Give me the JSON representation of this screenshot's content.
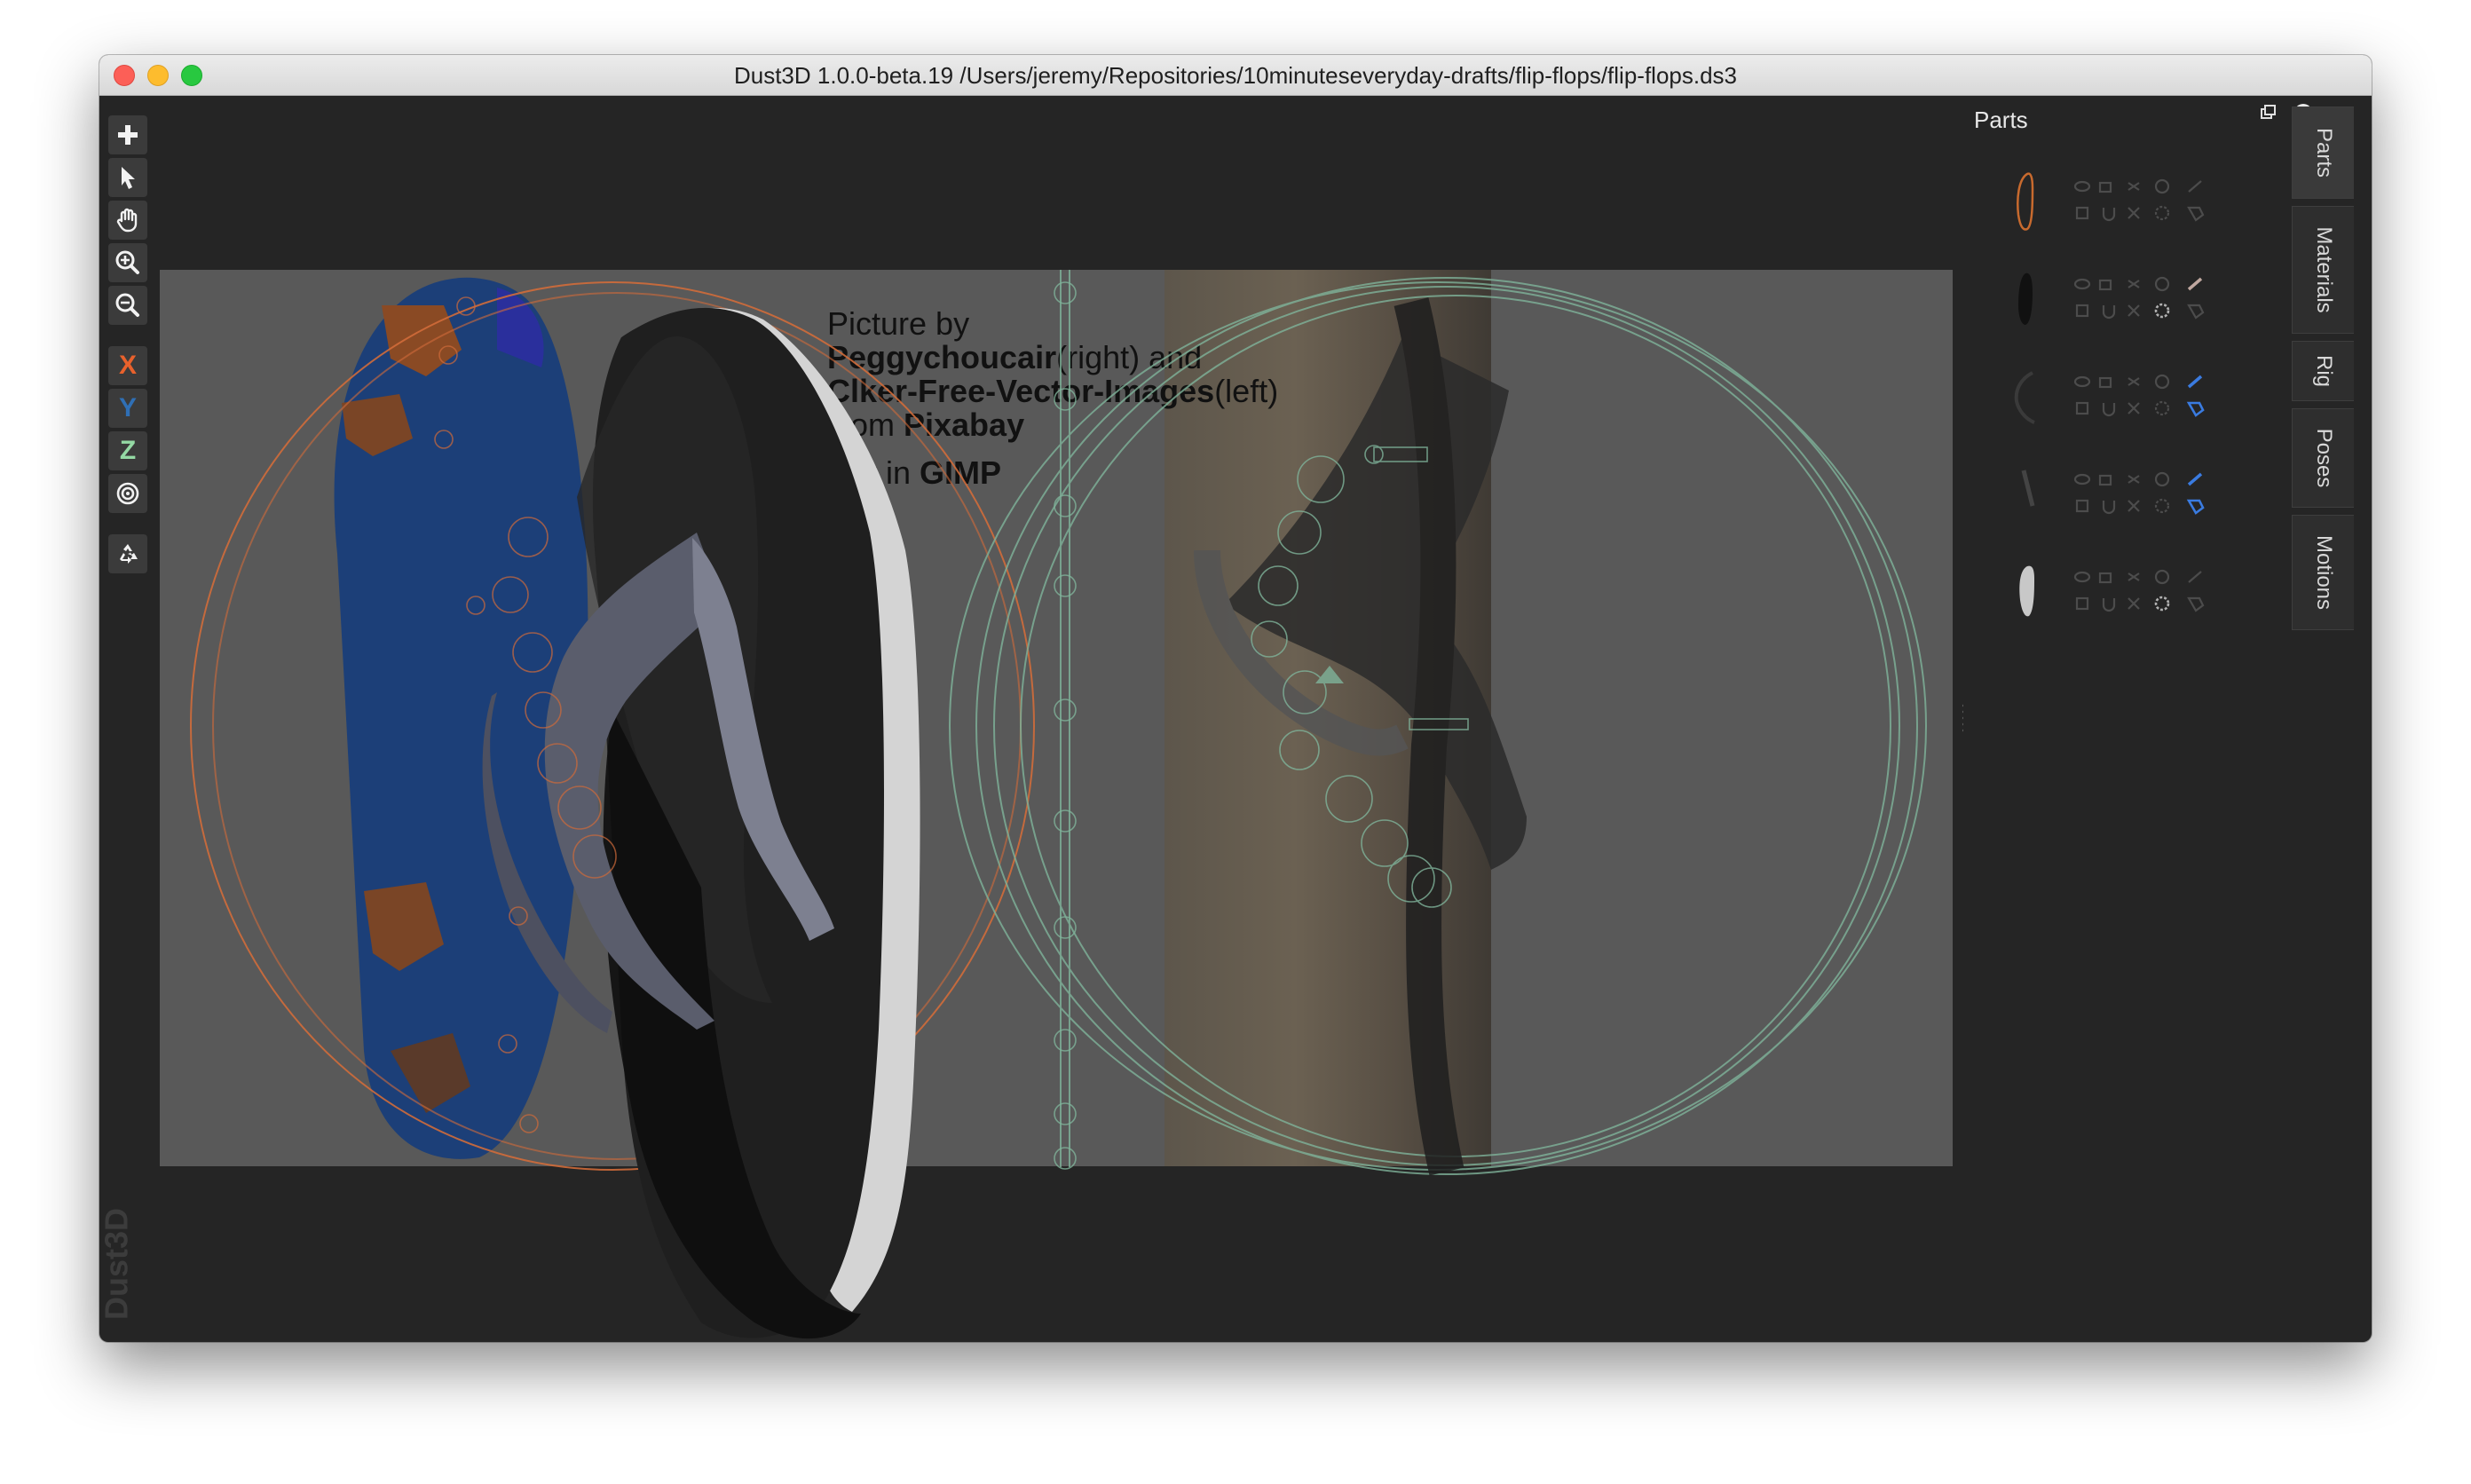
{
  "window": {
    "title": "Dust3D 1.0.0-beta.19 /Users/jeremy/Repositories/10minuteseveryday-drafts/flip-flops/flip-flops.ds3"
  },
  "toolbar": {
    "buttons": [
      {
        "icon": "plus-icon"
      },
      {
        "icon": "select-arrow-icon"
      },
      {
        "icon": "hand-pan-icon"
      },
      {
        "icon": "zoom-in-icon"
      },
      {
        "icon": "zoom-out-icon"
      }
    ],
    "axis_x": "X",
    "axis_y": "Y",
    "axis_z": "Z",
    "radius_icon": "radius-target-icon",
    "regenerate_icon": "recycle-icon",
    "colors": {
      "x": "#e8612c",
      "y": "#2f6fb5",
      "z": "#94d9a4"
    }
  },
  "watermark": "Dust3D",
  "viewport": {
    "credit": {
      "line1": "Picture by",
      "line2_bold": "Peggychoucair",
      "line2_rest": "(right) and",
      "line3_bold": "Clker-Free-Vector-Images",
      "line3_rest": "(left)",
      "line4_rest": "rom ",
      "line4_bold": "Pixabay",
      "line5_rest": "t in ",
      "line5_bold": "GIMP"
    },
    "colors": {
      "left_guides": "#d06b3a",
      "right_guides": "#7fb39a"
    }
  },
  "parts_panel": {
    "title": "Parts",
    "float_icon": "undock-icon",
    "close_icon": "close-icon",
    "parts": [
      {
        "thumb_color": "#c86a2e",
        "shape": "sole-outline"
      },
      {
        "thumb_color": "#111111",
        "shape": "black-sole"
      },
      {
        "thumb_color": "#3a3a3a",
        "shape": "strap-curve"
      },
      {
        "thumb_color": "#444444",
        "shape": "strap-thin"
      },
      {
        "thumb_color": "#c8c8c8",
        "shape": "white-sole"
      }
    ]
  },
  "side_tabs": [
    "Parts",
    "Materials",
    "Rig",
    "Poses",
    "Motions"
  ]
}
